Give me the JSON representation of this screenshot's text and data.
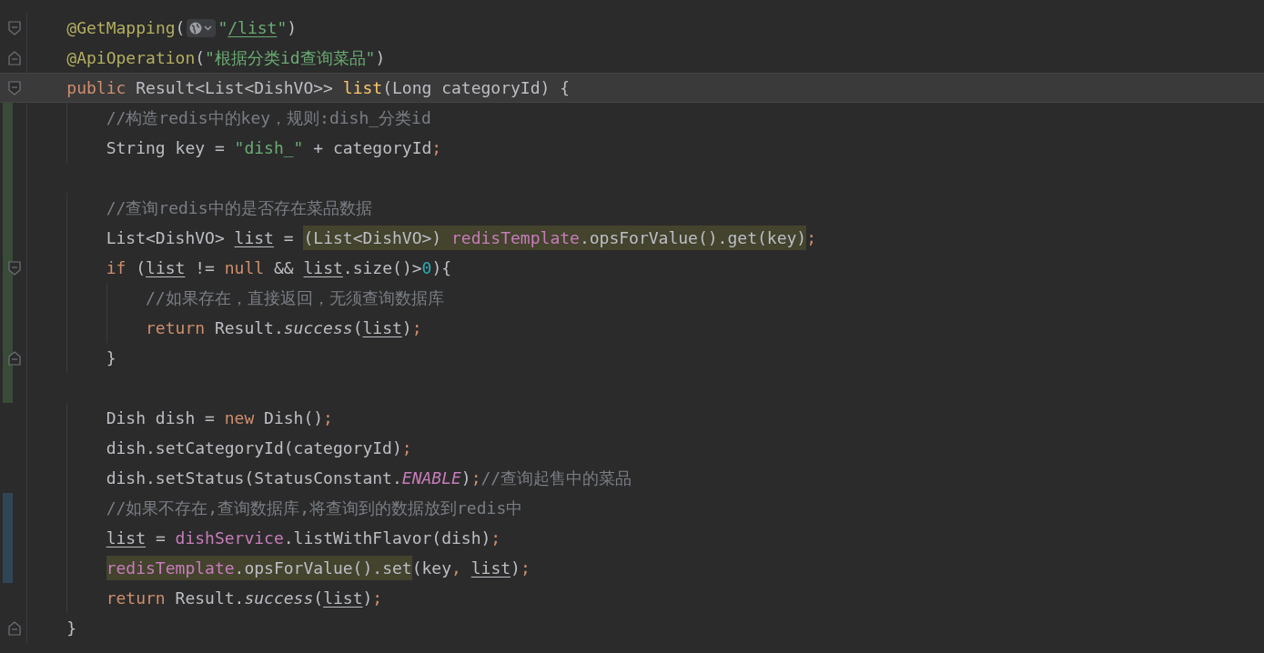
{
  "lines": [
    {
      "added": false,
      "modified": false,
      "fold_start": true,
      "fold_end": false,
      "current": false,
      "tokens": [
        {
          "kind": "ann",
          "text": "    @GetMapping"
        },
        {
          "kind": "txt",
          "text": "("
        },
        {
          "kind": "inlay"
        },
        {
          "kind": "str",
          "text": "\""
        },
        {
          "kind": "url",
          "text": "/list"
        },
        {
          "kind": "str",
          "text": "\""
        },
        {
          "kind": "txt",
          "text": ")"
        }
      ]
    },
    {
      "added": false,
      "modified": false,
      "fold_start": false,
      "fold_end": true,
      "current": false,
      "tokens": [
        {
          "kind": "ann",
          "text": "    @ApiOperation"
        },
        {
          "kind": "txt",
          "text": "("
        },
        {
          "kind": "str",
          "text": "\"根据分类id查询菜品\""
        },
        {
          "kind": "txt",
          "text": ")"
        }
      ]
    },
    {
      "added": false,
      "modified": false,
      "fold_start": true,
      "fold_end": false,
      "current": true,
      "tokens": [
        {
          "kind": "kw",
          "text": "    public"
        },
        {
          "kind": "txt",
          "text": " Result<List<DishVO>> "
        },
        {
          "kind": "decl",
          "text": "list"
        },
        {
          "kind": "txt",
          "text": "(Long categoryId) {"
        }
      ]
    },
    {
      "added": true,
      "modified": false,
      "fold_start": false,
      "fold_end": false,
      "current": false,
      "tokens": [
        {
          "kind": "cmt",
          "text": "        //构造redis中的key，规则:dish_分类id"
        }
      ]
    },
    {
      "added": true,
      "modified": false,
      "fold_start": false,
      "fold_end": false,
      "current": false,
      "tokens": [
        {
          "kind": "txt",
          "text": "        String key = "
        },
        {
          "kind": "str",
          "text": "\"dish_\""
        },
        {
          "kind": "txt",
          "text": " + categoryId"
        },
        {
          "kind": "punc",
          "text": ";"
        }
      ]
    },
    {
      "added": true,
      "modified": false,
      "fold_start": false,
      "fold_end": false,
      "current": false
    },
    {
      "added": true,
      "modified": false,
      "fold_start": false,
      "fold_end": false,
      "current": false,
      "tokens": [
        {
          "kind": "cmt",
          "text": "        //查询redis中的是否存在菜品数据"
        }
      ]
    },
    {
      "added": true,
      "modified": false,
      "fold_start": false,
      "fold_end": false,
      "current": false,
      "tokens": [
        {
          "kind": "txt",
          "text": "        List<DishVO> "
        },
        {
          "kind": "var",
          "text": "list"
        },
        {
          "kind": "txt",
          "text": " = "
        },
        {
          "kind": "match",
          "tokens": [
            {
              "kind": "txt",
              "text": "(List<DishVO>) "
            },
            {
              "kind": "fld",
              "text": "redisTemplate"
            },
            {
              "kind": "txt",
              "text": ".opsForValue().get(key)"
            }
          ]
        },
        {
          "kind": "punc",
          "text": ";"
        }
      ]
    },
    {
      "added": true,
      "modified": false,
      "fold_start": true,
      "fold_end": false,
      "current": false,
      "tokens": [
        {
          "kind": "kw",
          "text": "        if"
        },
        {
          "kind": "txt",
          "text": " ("
        },
        {
          "kind": "var",
          "text": "list"
        },
        {
          "kind": "txt",
          "text": " != "
        },
        {
          "kind": "kw",
          "text": "null"
        },
        {
          "kind": "txt",
          "text": " && "
        },
        {
          "kind": "var",
          "text": "list"
        },
        {
          "kind": "txt",
          "text": ".size()>"
        },
        {
          "kind": "num",
          "text": "0"
        },
        {
          "kind": "txt",
          "text": "){"
        }
      ]
    },
    {
      "added": true,
      "modified": false,
      "fold_start": false,
      "fold_end": false,
      "current": false,
      "tokens": [
        {
          "kind": "cmt",
          "text": "            //如果存在，直接返回，无须查询数据库"
        }
      ]
    },
    {
      "added": true,
      "modified": false,
      "fold_start": false,
      "fold_end": false,
      "current": false,
      "tokens": [
        {
          "kind": "kw",
          "text": "            return"
        },
        {
          "kind": "txt",
          "text": " Result."
        },
        {
          "kind": "static",
          "text": "success"
        },
        {
          "kind": "txt",
          "text": "("
        },
        {
          "kind": "var",
          "text": "list"
        },
        {
          "kind": "txt",
          "text": ")"
        },
        {
          "kind": "punc",
          "text": ";"
        }
      ]
    },
    {
      "added": true,
      "modified": false,
      "fold_start": false,
      "fold_end": true,
      "current": false,
      "tokens": [
        {
          "kind": "txt",
          "text": "        }"
        }
      ]
    },
    {
      "added": true,
      "modified": false,
      "fold_start": false,
      "fold_end": false,
      "current": false
    },
    {
      "added": false,
      "modified": false,
      "fold_start": false,
      "fold_end": false,
      "current": false,
      "tokens": [
        {
          "kind": "txt",
          "text": "        Dish dish = "
        },
        {
          "kind": "kw",
          "text": "new"
        },
        {
          "kind": "txt",
          "text": " Dish()"
        },
        {
          "kind": "punc",
          "text": ";"
        }
      ]
    },
    {
      "added": false,
      "modified": false,
      "fold_start": false,
      "fold_end": false,
      "current": false,
      "tokens": [
        {
          "kind": "txt",
          "text": "        dish.setCategoryId(categoryId)"
        },
        {
          "kind": "punc",
          "text": ";"
        }
      ]
    },
    {
      "added": false,
      "modified": false,
      "fold_start": false,
      "fold_end": false,
      "current": false,
      "tokens": [
        {
          "kind": "txt",
          "text": "        dish.setStatus(StatusConstant."
        },
        {
          "kind": "const",
          "text": "ENABLE"
        },
        {
          "kind": "txt",
          "text": ")"
        },
        {
          "kind": "punc",
          "text": ";"
        },
        {
          "kind": "cmt",
          "text": "//查询起售中的菜品"
        }
      ]
    },
    {
      "added": false,
      "modified": true,
      "fold_start": false,
      "fold_end": false,
      "current": false,
      "tokens": [
        {
          "kind": "cmt",
          "text": "        //如果不存在,查询数据库,将查询到的数据放到redis中"
        }
      ]
    },
    {
      "added": false,
      "modified": true,
      "fold_start": false,
      "fold_end": false,
      "current": false,
      "tokens": [
        {
          "kind": "var",
          "text": "        list"
        },
        {
          "kind": "txt",
          "text": " = "
        },
        {
          "kind": "fld",
          "text": "dishService"
        },
        {
          "kind": "txt",
          "text": ".listWithFlavor(dish)"
        },
        {
          "kind": "punc",
          "text": ";"
        }
      ]
    },
    {
      "added": false,
      "modified": true,
      "fold_start": false,
      "fold_end": false,
      "current": false,
      "tokens": [
        {
          "kind": "match",
          "tokens": [
            {
              "kind": "fld",
              "text": "        redisTemplate"
            },
            {
              "kind": "txt",
              "text": ".opsForValue().set"
            }
          ]
        },
        {
          "kind": "txt",
          "text": "(key"
        },
        {
          "kind": "punc",
          "text": ", "
        },
        {
          "kind": "var",
          "text": "list"
        },
        {
          "kind": "txt",
          "text": ")"
        },
        {
          "kind": "punc",
          "text": ";"
        }
      ]
    },
    {
      "added": false,
      "modified": false,
      "fold_start": false,
      "fold_end": false,
      "current": false,
      "tokens": [
        {
          "kind": "kw",
          "text": "        return"
        },
        {
          "kind": "txt",
          "text": " Result."
        },
        {
          "kind": "static",
          "text": "success"
        },
        {
          "kind": "txt",
          "text": "("
        },
        {
          "kind": "var",
          "text": "list"
        },
        {
          "kind": "txt",
          "text": ")"
        },
        {
          "kind": "punc",
          "text": ";"
        }
      ]
    },
    {
      "added": false,
      "modified": false,
      "fold_start": false,
      "fold_end": true,
      "current": false,
      "tokens": [
        {
          "kind": "txt",
          "text": "    }"
        }
      ]
    }
  ]
}
